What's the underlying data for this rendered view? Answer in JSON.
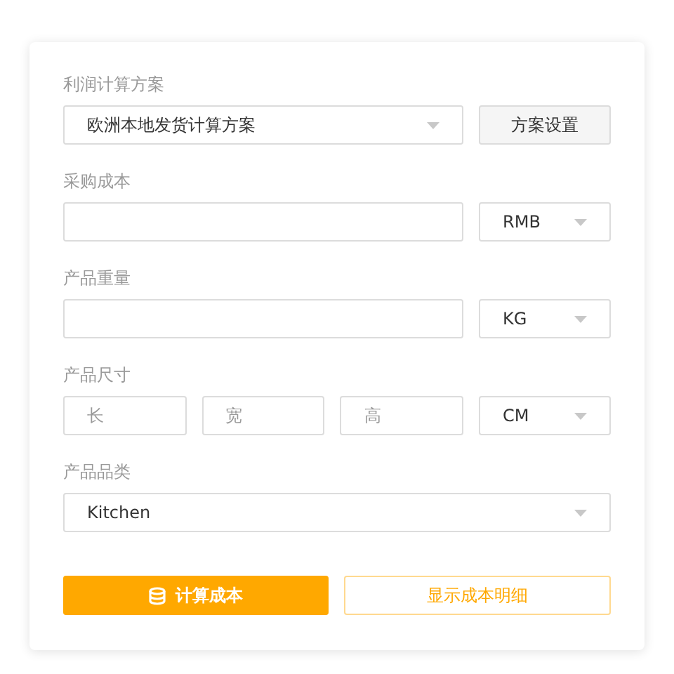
{
  "sections": [
    {
      "kind": "select-with-button",
      "label": "利润计算方案",
      "value": "欧洲本地发货计算方案",
      "button": "方案设置"
    },
    {
      "kind": "input-unit",
      "label": "采购成本",
      "unit": "RMB"
    },
    {
      "kind": "input-unit",
      "label": "产品重量",
      "unit": "KG"
    },
    {
      "kind": "dimensions",
      "label": "产品尺寸",
      "placeholders": [
        "长",
        "宽",
        "高"
      ],
      "unit": "CM"
    },
    {
      "kind": "select",
      "label": "产品品类",
      "value": "Kitchen"
    }
  ],
  "actions": {
    "calculate": "计算成本",
    "details": "显示成本明细"
  }
}
